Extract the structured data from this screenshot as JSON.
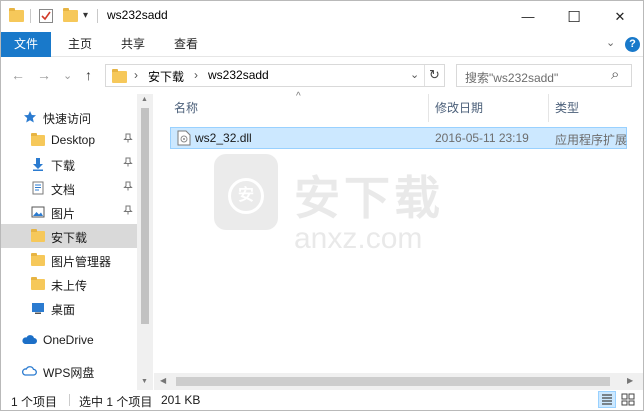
{
  "window": {
    "title": "ws232sadd",
    "controls": {
      "minimize": "—",
      "maximize": "☐",
      "close": "✕"
    }
  },
  "ribbon": {
    "tabs": [
      {
        "label": "文件",
        "active": true
      },
      {
        "label": "主页",
        "active": false
      },
      {
        "label": "共享",
        "active": false
      },
      {
        "label": "查看",
        "active": false
      }
    ],
    "expand_glyph": "⌄",
    "help": "?"
  },
  "navigation": {
    "back": "←",
    "forward": "→",
    "recent": "⌄",
    "up": "↑",
    "path": [
      {
        "label": "安下载"
      },
      {
        "label": "ws232sadd"
      }
    ],
    "path_separator": "›",
    "dropdown": "⌄",
    "refresh": "↻",
    "search_placeholder": "搜索\"ws232sadd\"",
    "search_icon": "⌕"
  },
  "sidebar": {
    "items": [
      {
        "label": "快速访问",
        "icon": "star-icon",
        "pinned": false
      },
      {
        "label": "Desktop",
        "icon": "folder-icon",
        "pinned": true
      },
      {
        "label": "下载",
        "icon": "download-icon",
        "pinned": true
      },
      {
        "label": "文档",
        "icon": "document-icon",
        "pinned": true
      },
      {
        "label": "图片",
        "icon": "picture-icon",
        "pinned": true
      },
      {
        "label": "安下载",
        "icon": "folder-icon",
        "pinned": false,
        "selected": true
      },
      {
        "label": "图片管理器",
        "icon": "folder-icon",
        "pinned": false
      },
      {
        "label": "未上传",
        "icon": "folder-icon",
        "pinned": false
      },
      {
        "label": "桌面",
        "icon": "desktop-icon",
        "pinned": false
      },
      {
        "label": "OneDrive",
        "icon": "cloud-icon",
        "pinned": false
      },
      {
        "label": "WPS网盘",
        "icon": "cloud-outline-icon",
        "pinned": false
      }
    ],
    "pin_glyph": "📌"
  },
  "columns": {
    "name": "名称",
    "modified": "修改日期",
    "type": "类型",
    "sort_glyph": "^"
  },
  "files": [
    {
      "name": "ws2_32.dll",
      "modified": "2016-05-11 23:19",
      "type": "应用程序扩展",
      "selected": true
    }
  ],
  "watermark": {
    "title": "安下载",
    "sub": "anxz.com",
    "badge": "安"
  },
  "status": {
    "count": "1 个项目",
    "selection": "选中 1 个项目",
    "size": "201 KB"
  },
  "colors": {
    "accent": "#1979ca",
    "selection_bg": "#cce8ff",
    "selection_border": "#99d1ff",
    "folder": "#f6c85a"
  }
}
